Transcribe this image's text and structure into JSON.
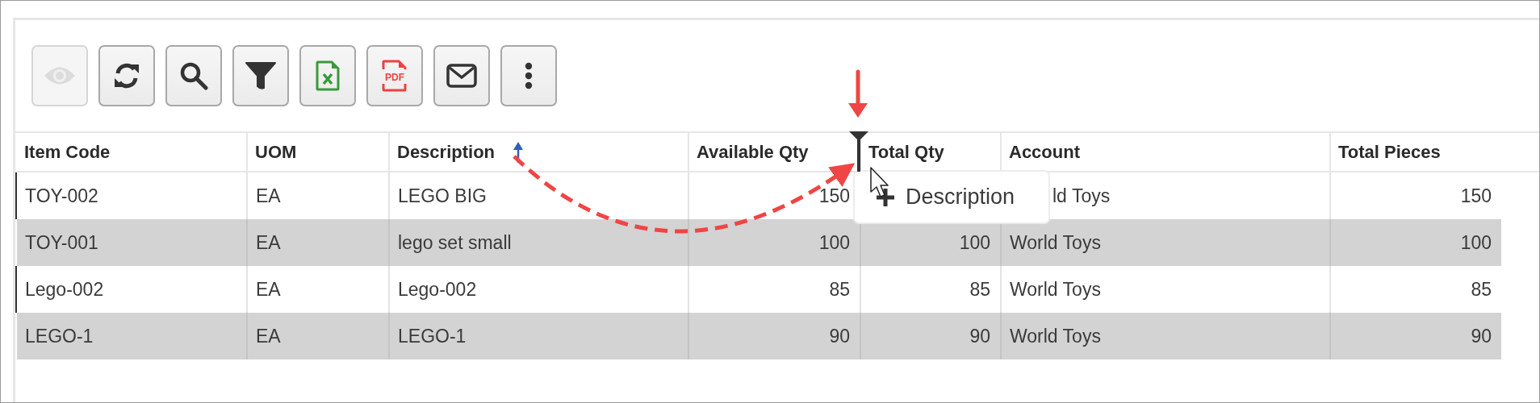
{
  "toolbar": [
    {
      "kind": "eye",
      "disabled": true
    },
    {
      "kind": "refresh",
      "disabled": false
    },
    {
      "kind": "search",
      "disabled": false
    },
    {
      "kind": "filter",
      "disabled": false
    },
    {
      "kind": "excel",
      "disabled": false
    },
    {
      "kind": "pdf",
      "disabled": false,
      "icon_text": "PDF"
    },
    {
      "kind": "mail",
      "disabled": false
    },
    {
      "kind": "more",
      "disabled": false
    }
  ],
  "table": {
    "columns": [
      {
        "label": "Item Code",
        "kind": "text",
        "sorted_ascending": false
      },
      {
        "label": "UOM",
        "kind": "text",
        "sorted_ascending": false
      },
      {
        "label": "Description",
        "kind": "text",
        "sorted_ascending": true
      },
      {
        "label": "Available Qty",
        "kind": "number",
        "sorted_ascending": false
      },
      {
        "label": "Total Qty",
        "kind": "number",
        "sorted_ascending": false
      },
      {
        "label": "Account",
        "kind": "text",
        "sorted_ascending": false
      },
      {
        "label": "Total Pieces",
        "kind": "number",
        "sorted_ascending": false
      }
    ],
    "rows": [
      {
        "cells": [
          "TOY-002",
          "EA",
          "LEGO BIG",
          "150",
          null,
          "ld Toys",
          "150"
        ]
      },
      {
        "cells": [
          "TOY-001",
          "EA",
          "lego set small",
          "100",
          "100",
          "World Toys",
          "100"
        ]
      },
      {
        "cells": [
          "Lego-002",
          "EA",
          "Lego-002",
          "85",
          "85",
          "World Toys",
          "85"
        ]
      },
      {
        "cells": [
          "LEGO-1",
          "EA",
          "LEGO-1",
          "90",
          "90",
          "World Toys",
          "90"
        ]
      }
    ]
  },
  "drag_hint": {
    "label": "Description"
  }
}
